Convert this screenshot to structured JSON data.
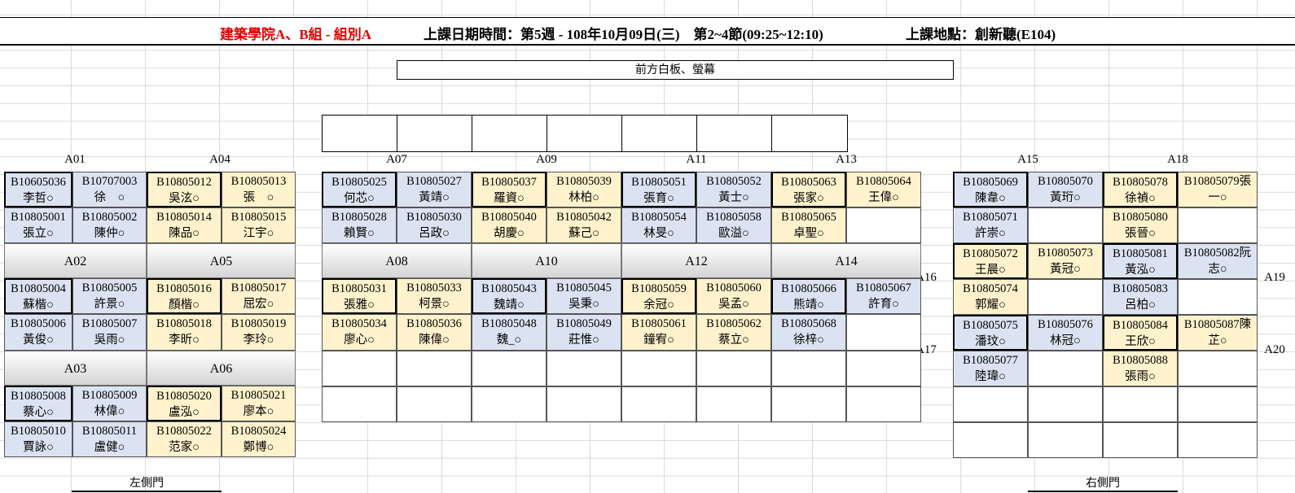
{
  "header": {
    "title": "建築學院A、B組 - 組別A",
    "datetime": "上課日期時間：第5週 - 108年10月09日(三)　第2~4節(09:25~12:10)",
    "location": "上課地點：創新聽(E104)"
  },
  "screen_label": "前方白板、螢幕",
  "group_labels": {
    "A01": "A01",
    "A04": "A04",
    "A07": "A07",
    "A09": "A09",
    "A11": "A11",
    "A13": "A13",
    "A15": "A15",
    "A18": "A18",
    "A02": "A02",
    "A05": "A05",
    "A08": "A08",
    "A10": "A10",
    "A12": "A12",
    "A14": "A14",
    "A03": "A03",
    "A06": "A06",
    "A16": "A16",
    "A17": "A17",
    "A19": "A19",
    "A20": "A20"
  },
  "doors": {
    "left": "左側門",
    "right": "右側門"
  },
  "colors": {
    "blue": "#dbe3f3",
    "yellow": "#fff2cc",
    "title_red": "#e00000"
  },
  "seats": {
    "s1": {
      "id": "B10605036",
      "name": "李哲○"
    },
    "s2": {
      "id": "B10707003",
      "name": "徐　○"
    },
    "s3": {
      "id": "B10805001",
      "name": "張立○"
    },
    "s4": {
      "id": "B10805002",
      "name": "陳仲○"
    },
    "s5": {
      "id": "B10805012",
      "name": "吳泫○"
    },
    "s6": {
      "id": "B10805013",
      "name": "張　○"
    },
    "s7": {
      "id": "B10805014",
      "name": "陳品○"
    },
    "s8": {
      "id": "B10805015",
      "name": "江宇○"
    },
    "s9": {
      "id": "B10805004",
      "name": "蘇楷○"
    },
    "s10": {
      "id": "B10805005",
      "name": "許景○"
    },
    "s11": {
      "id": "B10805006",
      "name": "黃俊○"
    },
    "s12": {
      "id": "B10805007",
      "name": "吳雨○"
    },
    "s13": {
      "id": "B10805016",
      "name": "顏楷○"
    },
    "s14": {
      "id": "B10805017",
      "name": "屈宏○"
    },
    "s15": {
      "id": "B10805018",
      "name": "李昕○"
    },
    "s16": {
      "id": "B10805019",
      "name": "李玲○"
    },
    "s17": {
      "id": "B10805008",
      "name": "蔡心○"
    },
    "s18": {
      "id": "B10805009",
      "name": "林偉○"
    },
    "s19": {
      "id": "B10805010",
      "name": "賈詠○"
    },
    "s20": {
      "id": "B10805011",
      "name": "盧健○"
    },
    "s21": {
      "id": "B10805020",
      "name": "盧泓○"
    },
    "s22": {
      "id": "B10805021",
      "name": "廖本○"
    },
    "s23": {
      "id": "B10805022",
      "name": "范家○"
    },
    "s24": {
      "id": "B10805024",
      "name": "鄭博○"
    },
    "s25": {
      "id": "B10805025",
      "name": "何芯○"
    },
    "s26": {
      "id": "B10805027",
      "name": "黃靖○"
    },
    "s27": {
      "id": "B10805028",
      "name": "賴賢○"
    },
    "s28": {
      "id": "B10805030",
      "name": "呂政○"
    },
    "s29": {
      "id": "B10805037",
      "name": "羅資○"
    },
    "s30": {
      "id": "B10805039",
      "name": "林柏○"
    },
    "s31": {
      "id": "B10805040",
      "name": "胡慶○"
    },
    "s32": {
      "id": "B10805042",
      "name": "蘇己○"
    },
    "s33": {
      "id": "B10805051",
      "name": "張育○"
    },
    "s34": {
      "id": "B10805052",
      "name": "黃士○"
    },
    "s35": {
      "id": "B10805054",
      "name": "林旻○"
    },
    "s36": {
      "id": "B10805058",
      "name": "歐溢○"
    },
    "s37": {
      "id": "B10805063",
      "name": "張家○"
    },
    "s38": {
      "id": "B10805064",
      "name": "王偉○"
    },
    "s39": {
      "id": "B10805065",
      "name": "卓聖○"
    },
    "s40": {
      "id": "B10805031",
      "name": "張雅○"
    },
    "s41": {
      "id": "B10805033",
      "name": "柯景○"
    },
    "s42": {
      "id": "B10805034",
      "name": "廖心○"
    },
    "s43": {
      "id": "B10805036",
      "name": "陳偉○"
    },
    "s44": {
      "id": "B10805043",
      "name": "魏靖○"
    },
    "s45": {
      "id": "B10805045",
      "name": "吳秉○"
    },
    "s46": {
      "id": "B10805048",
      "name": "魏_○"
    },
    "s47": {
      "id": "B10805049",
      "name": "莊惟○"
    },
    "s48": {
      "id": "B10805059",
      "name": "余冠○"
    },
    "s49": {
      "id": "B10805060",
      "name": "吳孟○"
    },
    "s50": {
      "id": "B10805061",
      "name": "鐘宥○"
    },
    "s51": {
      "id": "B10805062",
      "name": "蔡立○"
    },
    "s52": {
      "id": "B10805066",
      "name": "熊靖○"
    },
    "s53": {
      "id": "B10805067",
      "name": "許育○"
    },
    "s54": {
      "id": "B10805068",
      "name": "徐梓○"
    },
    "s55": {
      "id": "B10805069",
      "name": "陳韋○"
    },
    "s56": {
      "id": "B10805070",
      "name": "黃珩○"
    },
    "s57": {
      "id": "B10805078",
      "name": "徐禎○"
    },
    "s58": {
      "id": "B10805079張",
      "name": "一○"
    },
    "s59": {
      "id": "B10805071",
      "name": "許崇○"
    },
    "s60": {
      "id": "B10805080",
      "name": "張晉○"
    },
    "s61": {
      "id": "B10805072",
      "name": "王晨○"
    },
    "s62": {
      "id": "B10805073",
      "name": "黃冠○"
    },
    "s63": {
      "id": "B10805081",
      "name": "黃泓○"
    },
    "s64": {
      "id": "B10805082阮",
      "name": "志○"
    },
    "s65": {
      "id": "B10805074",
      "name": "郭耀○"
    },
    "s66": {
      "id": "B10805083",
      "name": "呂柏○"
    },
    "s67": {
      "id": "B10805075",
      "name": "潘玟○"
    },
    "s68": {
      "id": "B10805076",
      "name": "林冠○"
    },
    "s69": {
      "id": "B10805084",
      "name": "王欣○"
    },
    "s70": {
      "id": "B10805087陳",
      "name": "芷○"
    },
    "s71": {
      "id": "B10805077",
      "name": "陸瑋○"
    },
    "s72": {
      "id": "B10805088",
      "name": "張雨○"
    }
  }
}
